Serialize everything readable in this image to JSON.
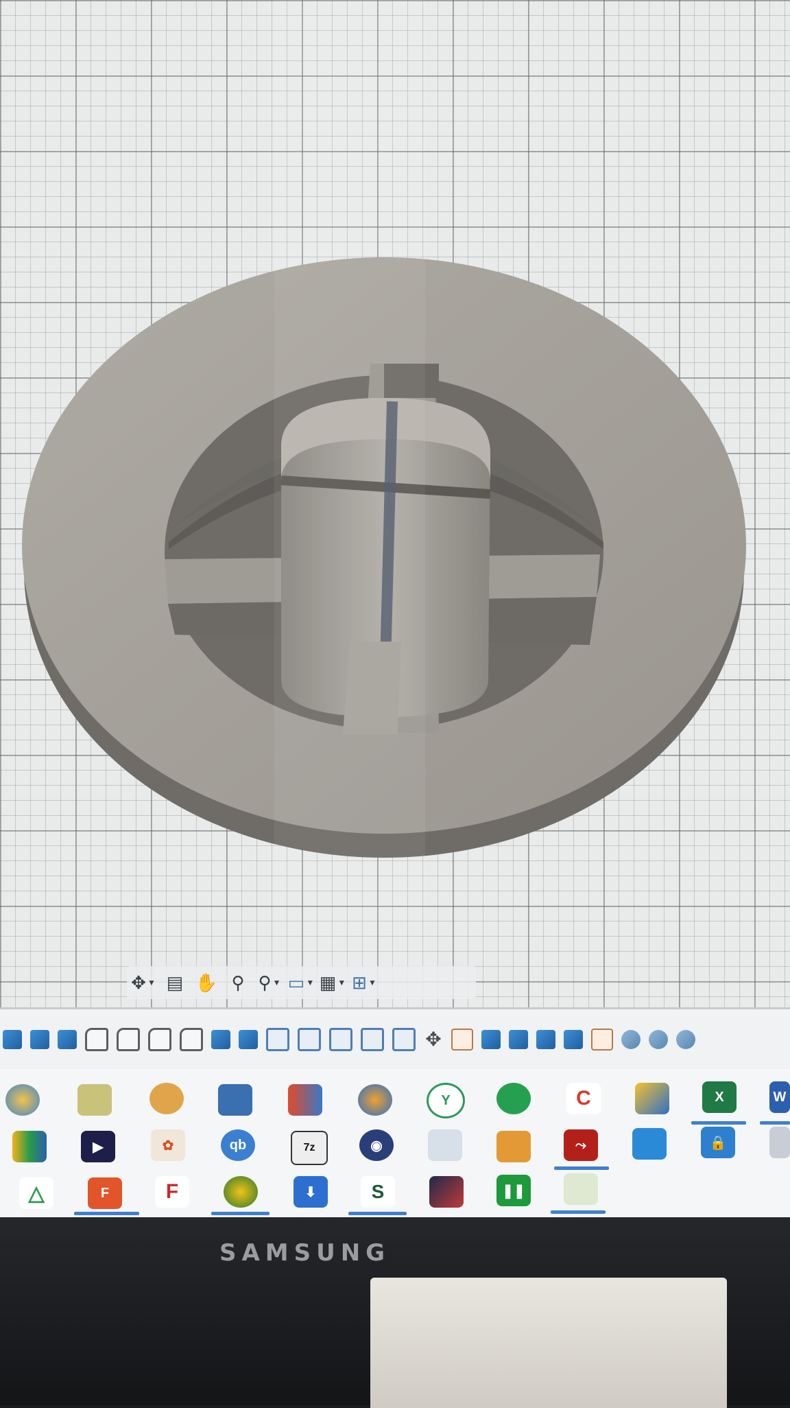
{
  "monitor": {
    "brand": "SAMSUNG"
  },
  "navigation_bar": {
    "tools": [
      "orbit-icon",
      "look-at-icon",
      "pan-hand-icon",
      "zoom-icon",
      "zoom-window-icon",
      "display-settings-icon",
      "grid-settings-icon",
      "viewports-icon"
    ]
  },
  "toolbar_icons": [
    "solid-box",
    "solid-box",
    "solid-box",
    "fillet",
    "fillet",
    "fillet",
    "fillet",
    "solid-box",
    "solid-box",
    "box-outline",
    "box-outline",
    "box-outline",
    "box-outline",
    "joint",
    "move",
    "sketch",
    "solid-box",
    "solid-box",
    "solid-box",
    "solid-box",
    "sketch",
    "round",
    "round",
    "round"
  ],
  "colors": {
    "viewport_bg": "#e9ebea",
    "model_top": "#a8a49e",
    "model_side": "#7d7a75",
    "accent_blue": "#3f7fd0"
  }
}
